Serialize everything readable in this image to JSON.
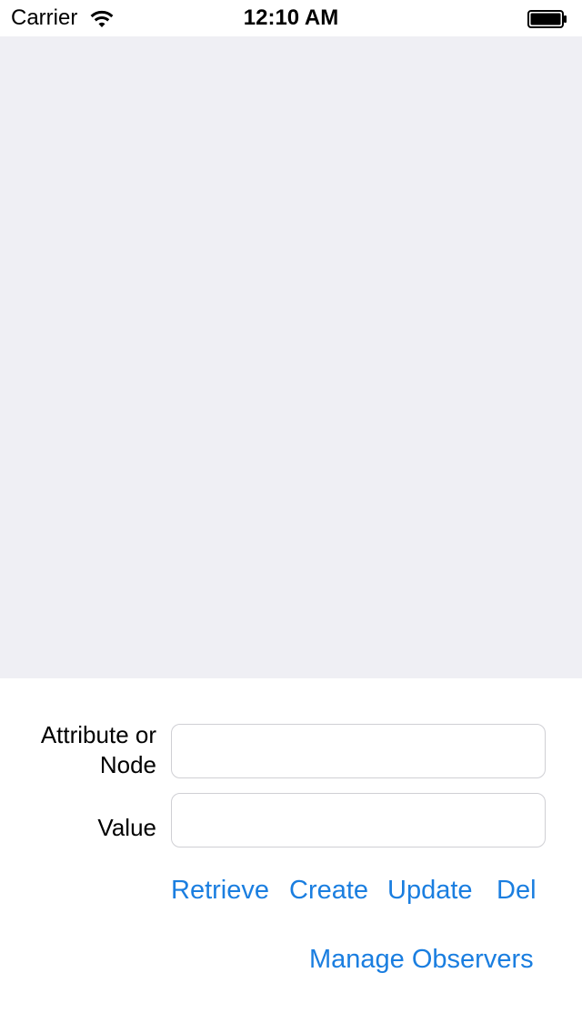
{
  "status_bar": {
    "carrier": "Carrier",
    "time": "12:10 AM",
    "wifi_icon": "wifi-icon",
    "battery_icon": "battery-icon"
  },
  "colors": {
    "table_background": "#efeff4",
    "tint": "#1a7ee0",
    "field_border": "#cfcfd4"
  },
  "form": {
    "attribute_label": "Attribute or Node",
    "attribute_value": "",
    "value_label": "Value",
    "value_value": ""
  },
  "actions": {
    "retrieve": "Retrieve",
    "create": "Create",
    "update": "Update",
    "delete": "Del",
    "manage_observers": "Manage Observers"
  }
}
